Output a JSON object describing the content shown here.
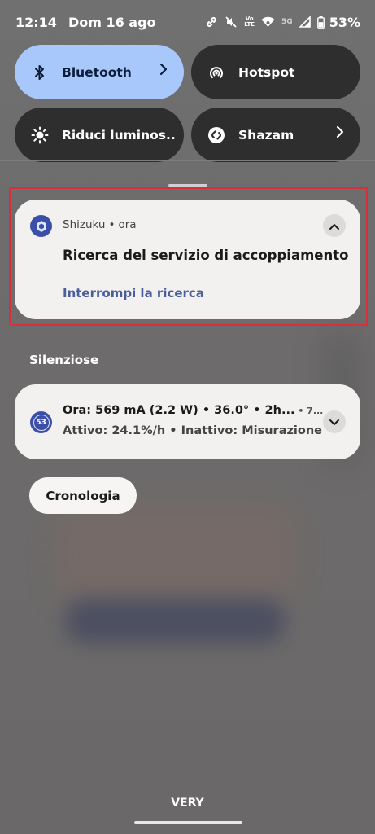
{
  "status_bar": {
    "time": "12:14",
    "date": "Dom 16 ago",
    "network_label": "5G",
    "volte_top": "Vo",
    "volte_bottom": "LTE",
    "battery": "53%"
  },
  "quick_settings": {
    "tiles": [
      {
        "label": "Bluetooth",
        "icon": "bluetooth-icon",
        "active": true,
        "has_chevron": true
      },
      {
        "label": "Hotspot",
        "icon": "hotspot-icon",
        "active": false,
        "has_chevron": false
      },
      {
        "label": "Riduci luminos..",
        "icon": "brightness-icon",
        "active": false,
        "has_chevron": false
      },
      {
        "label": "Shazam",
        "icon": "shazam-icon",
        "active": false,
        "has_chevron": true
      }
    ]
  },
  "notification": {
    "app_name": "Shizuku",
    "time": "ora",
    "title": "Ricerca del servizio di accoppiamento",
    "action": "Interrompi la ricerca"
  },
  "silent_section": {
    "label": "Silenziose",
    "battery_notification": {
      "icon_text": "53",
      "line1": "Ora: 569 mA (2.2 W) • 36.0° • 2h...",
      "line1_tail": " • 7...",
      "line2": "Attivo: 24.1%/h • Inattivo: Misurazione"
    }
  },
  "history_button": "Cronologia",
  "carrier": "VERY",
  "colors": {
    "tile_active": "#a8c7fa",
    "tile_inactive": "#2e2e2e",
    "card_bg": "#f2f1ef",
    "action_text": "#4a5e9a",
    "highlight": "#d8303a"
  }
}
